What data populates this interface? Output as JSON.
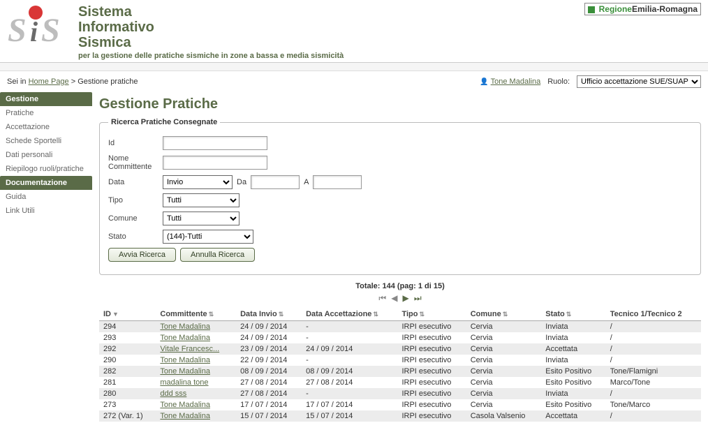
{
  "header": {
    "title_l1": "Sistema",
    "title_l2": "Informativo",
    "title_l3": "Sismica",
    "subtitle": "per la gestione delle pratiche sismiche in zone a bassa e media sismicità",
    "region_prefix": "Regione",
    "region_name": "Emilia-Romagna"
  },
  "breadcrumb": {
    "prefix": "Sei in ",
    "home": "Home Page",
    "sep": " > ",
    "current": "Gestione pratiche"
  },
  "user": {
    "name": "Tone Madalina"
  },
  "role": {
    "label": "Ruolo:",
    "selected": "Ufficio accettazione SUE/SUAP"
  },
  "sidebar": {
    "group1": {
      "title": "Gestione",
      "items": [
        "Pratiche",
        "Accettazione",
        "Schede Sportelli",
        "Dati personali",
        "Riepilogo ruoli/pratiche"
      ]
    },
    "group2": {
      "title": "Documentazione",
      "items": [
        "Guida",
        "Link Utili"
      ]
    }
  },
  "page": {
    "title": "Gestione Pratiche"
  },
  "search": {
    "legend": "Ricerca Pratiche Consegnate",
    "id_label": "Id",
    "nome_label": "Nome Committente",
    "data_label": "Data",
    "data_select": "Invio",
    "da_label": "Da",
    "a_label": "A",
    "tipo_label": "Tipo",
    "tipo_select": "Tutti",
    "comune_label": "Comune",
    "comune_select": "Tutti",
    "stato_label": "Stato",
    "stato_select": "(144)-Tutti",
    "btn_search": "Avvia Ricerca",
    "btn_reset": "Annulla Ricerca"
  },
  "pager": {
    "summary": "Totale: 144 (pag: 1 di 15)"
  },
  "table": {
    "headers": [
      "ID",
      "Committente",
      "Data Invio",
      "Data Accettazione",
      "Tipo",
      "Comune",
      "Stato",
      "Tecnico 1/Tecnico 2"
    ],
    "rows": [
      {
        "id": "294",
        "committente": "Tone Madalina",
        "invio": "24 / 09 / 2014",
        "accett": "-",
        "tipo": "IRPI esecutivo",
        "comune": "Cervia",
        "stato": "Inviata",
        "tecnico": "/"
      },
      {
        "id": "293",
        "committente": "Tone Madalina",
        "invio": "24 / 09 / 2014",
        "accett": "-",
        "tipo": "IRPI esecutivo",
        "comune": "Cervia",
        "stato": "Inviata",
        "tecnico": "/"
      },
      {
        "id": "292",
        "committente": "Vitale Francesc...",
        "invio": "23 / 09 / 2014",
        "accett": "24 / 09 / 2014",
        "tipo": "IRPI esecutivo",
        "comune": "Cervia",
        "stato": "Accettata",
        "tecnico": "/"
      },
      {
        "id": "290",
        "committente": "Tone Madalina",
        "invio": "22 / 09 / 2014",
        "accett": "-",
        "tipo": "IRPI esecutivo",
        "comune": "Cervia",
        "stato": "Inviata",
        "tecnico": "/"
      },
      {
        "id": "282",
        "committente": "Tone Madalina",
        "invio": "08 / 09 / 2014",
        "accett": "08 / 09 / 2014",
        "tipo": "IRPI esecutivo",
        "comune": "Cervia",
        "stato": "Esito Positivo",
        "tecnico": "Tone/Flamigni"
      },
      {
        "id": "281",
        "committente": "madalina tone",
        "invio": "27 / 08 / 2014",
        "accett": "27 / 08 / 2014",
        "tipo": "IRPI esecutivo",
        "comune": "Cervia",
        "stato": "Esito Positivo",
        "tecnico": "Marco/Tone"
      },
      {
        "id": "280",
        "committente": "ddd sss",
        "invio": "27 / 08 / 2014",
        "accett": "-",
        "tipo": "IRPI esecutivo",
        "comune": "Cervia",
        "stato": "Inviata",
        "tecnico": "/"
      },
      {
        "id": "273",
        "committente": "Tone Madalina",
        "invio": "17 / 07 / 2014",
        "accett": "17 / 07 / 2014",
        "tipo": "IRPI esecutivo",
        "comune": "Cervia",
        "stato": "Esito Positivo",
        "tecnico": "Tone/Marco"
      },
      {
        "id": "272 (Var. 1)",
        "committente": "Tone Madalina",
        "invio": "15 / 07 / 2014",
        "accett": "15 / 07 / 2014",
        "tipo": "IRPI esecutivo",
        "comune": "Casola Valsenio",
        "stato": "Accettata",
        "tecnico": "/"
      }
    ]
  }
}
